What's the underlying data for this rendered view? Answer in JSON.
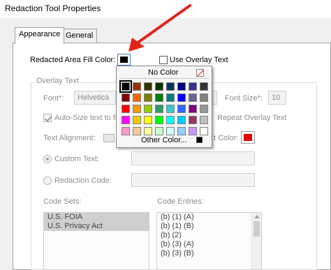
{
  "window": {
    "title": "Redaction Tool Properties"
  },
  "tabs": [
    {
      "label": "Appearance"
    },
    {
      "label": "General"
    }
  ],
  "fill": {
    "label": "Redacted Area Fill Color:",
    "color": "#000000",
    "overlay_checkbox_label": "Use Overlay Text"
  },
  "overlay": {
    "group_label": "Overlay Text",
    "font_label": "Font*:",
    "font_value": "Helvetica",
    "font_size_label": "Font Size*:",
    "font_size_value": "10",
    "autosize_label": "Auto-Size text to fit",
    "repeat_label": "Repeat Overlay Text",
    "alignment_label": "Text Alignment:",
    "text_color_label": "t Color:",
    "text_color": "#e00000",
    "custom_text_label": "Custom Text:",
    "redaction_code_label": "Redaction Code:",
    "code_sets_label": "Code Sets:",
    "code_entries_label": "Code Entries:",
    "code_sets": [
      "U.S. FOIA",
      "U.S. Privacy Act"
    ],
    "code_entries": [
      "(b) (1) (A)",
      "(b) (1) (B)",
      "(b) (2)",
      "(b) (3) (A)",
      "(b) (3) (B)"
    ]
  },
  "color_popup": {
    "no_color_label": "No Color",
    "other_color_label": "Other Color...",
    "other_color_value": "#000000",
    "grid": [
      [
        "#000000",
        "#993300",
        "#333300",
        "#003300",
        "#003366",
        "#000080",
        "#333399",
        "#333333"
      ],
      [
        "#800000",
        "#ff6600",
        "#808000",
        "#008000",
        "#008080",
        "#0000ff",
        "#666699",
        "#808080"
      ],
      [
        "#ff0000",
        "#ff9900",
        "#99cc00",
        "#339966",
        "#33cccc",
        "#3366ff",
        "#800080",
        "#969696"
      ],
      [
        "#ff00ff",
        "#ffcc00",
        "#ffff00",
        "#00ff00",
        "#00ffff",
        "#00ccff",
        "#993366",
        "#c0c0c0"
      ],
      [
        "#ff99cc",
        "#ffcc99",
        "#ffff99",
        "#ccffcc",
        "#ccffff",
        "#99ccff",
        "#cc99ff",
        "#ffffff"
      ]
    ]
  },
  "annotation": {
    "arrow_color": "#e2231a"
  }
}
